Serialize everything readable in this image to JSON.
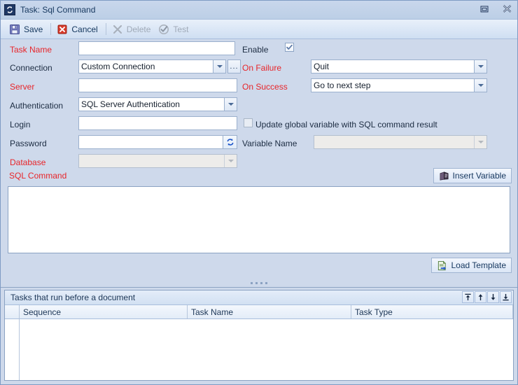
{
  "window": {
    "title": "Task: Sql Command",
    "app_icon": "sync-arrows-icon",
    "restore_label": "Restore",
    "close_label": "Close"
  },
  "toolbar": {
    "items": [
      {
        "label": "Save",
        "icon": "floppy-disk-icon",
        "enabled": true
      },
      {
        "label": "Cancel",
        "icon": "red-x-icon",
        "enabled": true
      },
      {
        "label": "Delete",
        "icon": "gray-x-icon",
        "enabled": false
      },
      {
        "label": "Test",
        "icon": "check-circle-icon",
        "enabled": false
      }
    ]
  },
  "form": {
    "task_name": {
      "label": "Task Name",
      "required": true,
      "value": "",
      "placeholder": ""
    },
    "connection": {
      "label": "Connection",
      "required": false,
      "value": "Custom Connection",
      "ellipsis": "..."
    },
    "server": {
      "label": "Server",
      "required": true,
      "value": "",
      "placeholder": ""
    },
    "authentication": {
      "label": "Authentication",
      "required": false,
      "value": "SQL Server Authentication"
    },
    "login": {
      "label": "Login",
      "required": false,
      "value": "",
      "placeholder": ""
    },
    "password": {
      "label": "Password",
      "required": false,
      "value": "",
      "placeholder": "",
      "refresh_icon": "refresh-icon"
    },
    "database": {
      "label": "Database",
      "required": true,
      "value": "",
      "disabled": true
    },
    "enable": {
      "label": "Enable",
      "checked": true
    },
    "on_failure": {
      "label": "On Failure",
      "required": true,
      "value": "Quit"
    },
    "on_success": {
      "label": "On Success",
      "required": true,
      "value": "Go to next step"
    },
    "update_global": {
      "label": "Update global variable with SQL command result",
      "checked": false
    },
    "variable_name": {
      "label": "Variable Name",
      "value": "",
      "disabled": true
    }
  },
  "sql": {
    "label": "SQL Command",
    "text": "",
    "insert_variable": "Insert Variable",
    "insert_variable_icon": "insert-variable-icon",
    "load_template": "Load Template",
    "load_template_icon": "load-template-icon"
  },
  "grid": {
    "title": "Tasks that run before a document",
    "tools": [
      {
        "name": "move-to-top-button"
      },
      {
        "name": "move-up-button"
      },
      {
        "name": "move-down-button"
      },
      {
        "name": "move-to-bottom-button"
      }
    ],
    "columns": [
      "Sequence",
      "Task Name",
      "Task Type"
    ],
    "rows": []
  },
  "colors": {
    "required_label": "#e8252a",
    "label": "#1c2c42",
    "window_bg": "#ced9eb",
    "border": "#8ba2c2",
    "title_text": "#16375e"
  }
}
